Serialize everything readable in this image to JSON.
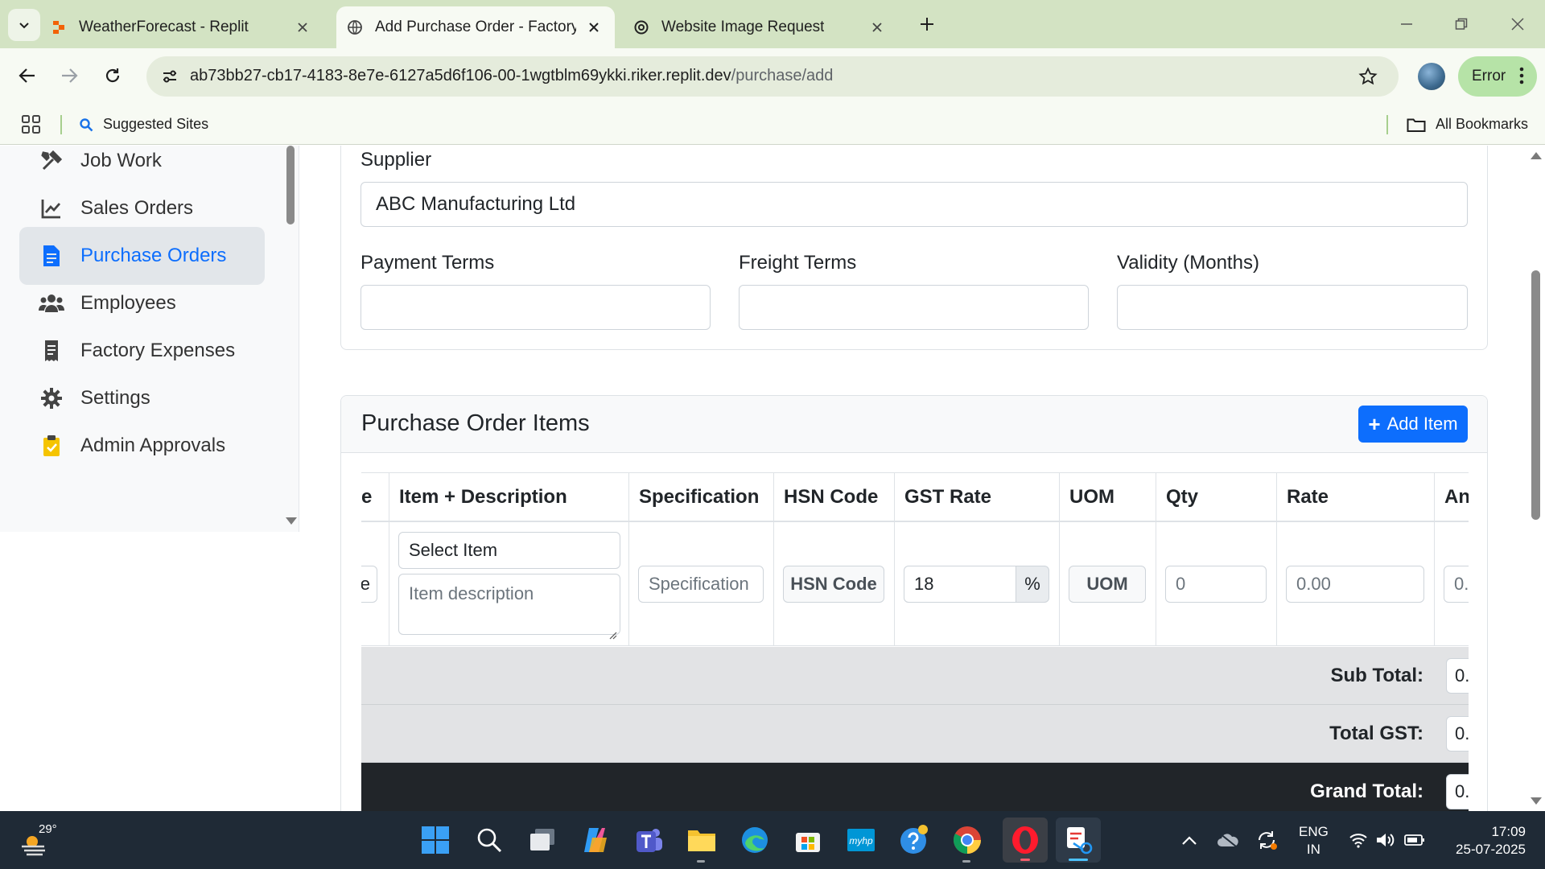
{
  "browser": {
    "tabs": [
      {
        "title": "WeatherForecast - Replit",
        "active": false
      },
      {
        "title": "Add Purchase Order - Factory Management",
        "active": true
      },
      {
        "title": "Website Image Request",
        "active": false
      }
    ],
    "url_host": "ab73bb27-cb17-4183-8e7e-6127a5d6f106-00-1wgtblm69ykki.riker.replit.dev",
    "url_path": "/purchase/add",
    "profile_status": "Error",
    "bookmarks": {
      "suggested": "Suggested Sites",
      "all": "All Bookmarks"
    }
  },
  "sidebar": {
    "items": [
      {
        "label": "Job Work",
        "icon": "tools-icon",
        "active": false
      },
      {
        "label": "Sales Orders",
        "icon": "chart-line-icon",
        "active": false
      },
      {
        "label": "Purchase Orders",
        "icon": "file-invoice-icon",
        "active": true
      },
      {
        "label": "Employees",
        "icon": "users-icon",
        "active": false
      },
      {
        "label": "Factory Expenses",
        "icon": "receipt-icon",
        "active": false
      },
      {
        "label": "Settings",
        "icon": "gear-icon",
        "active": false
      },
      {
        "label": "Admin Approvals",
        "icon": "clipboard-check-icon",
        "active": false
      }
    ]
  },
  "form": {
    "supplier_label": "Supplier",
    "supplier_value": "ABC Manufacturing Ltd",
    "payment_terms_label": "Payment Terms",
    "payment_terms_value": "",
    "freight_terms_label": "Freight Terms",
    "freight_terms_value": "",
    "validity_label": "Validity (Months)",
    "validity_value": ""
  },
  "items_card": {
    "title": "Purchase Order Items",
    "add_button": "Add Item",
    "columns": [
      "e",
      "Item + Description",
      "Specification",
      "HSN Code",
      "GST Rate",
      "UOM",
      "Qty",
      "Rate",
      "An"
    ],
    "row": {
      "first_cell": "e",
      "select_item": "Select Item",
      "description_placeholder": "Item description",
      "specification_placeholder": "Specification",
      "hsn_code": "HSN Code",
      "gst_rate": "18",
      "gst_suffix": "%",
      "uom": "UOM",
      "qty": "0",
      "rate": "0.00",
      "amount": "0."
    },
    "totals": [
      {
        "label": "Sub Total:",
        "value": "0."
      },
      {
        "label": "Total GST:",
        "value": "0."
      },
      {
        "label": "Grand Total:",
        "value": "0."
      }
    ]
  },
  "taskbar": {
    "temperature": "29°",
    "lang_line1": "ENG",
    "lang_line2": "IN",
    "time": "17:09",
    "date": "25-07-2025"
  },
  "colors": {
    "primary": "#0d6efd",
    "tab_strip": "#d3e3c3",
    "taskbar": "#1f2a36",
    "dark_row": "#212529"
  }
}
